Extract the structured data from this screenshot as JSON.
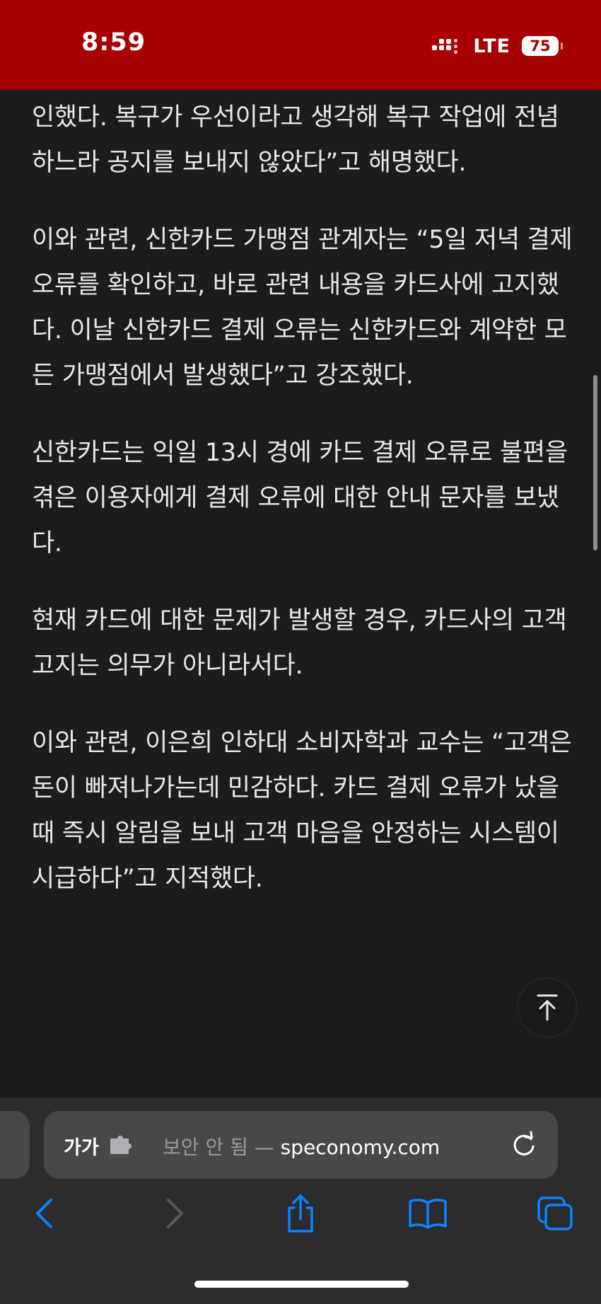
{
  "status_bar": {
    "time": "8:59",
    "network": "LTE",
    "battery_level": "75",
    "background_color": "#a80000"
  },
  "article": {
    "paragraphs": [
      "인했다. 복구가 우선이라고 생각해 복구 작업에 전념하느라 공지를 보내지 않았다”고 해명했다.",
      "이와 관련, 신한카드 가맹점 관계자는 “5일 저녁 결제 오류를 확인하고, 바로 관련 내용을 카드사에 고지했다. 이날 신한카드 결제 오류는 신한카드와 계약한 모든 가맹점에서 발생했다”고 강조했다.",
      "신한카드는 익일 13시 경에 카드 결제 오류로 불편을 겪은 이용자에게 결제 오류에 대한 안내 문자를 보냈다.",
      "현재 카드에 대한 문제가 발생할 경우, 카드사의 고객 고지는 의무가 아니라서다.",
      "이와 관련, 이은희 인하대 소비자학과 교수는 “고객은 돈이 빠져나가는데 민감하다. 카드 결제 오류가 났을 때 즉시 알림을 보내 고객 마음을 안정하는 시스템이 시급하다”고 지적했다."
    ]
  },
  "address_bar": {
    "reader_label": "가가",
    "security_prefix": "보안 안 됨 —",
    "domain": "speconomy.com"
  },
  "icons": {
    "scroll_top": "arrow-up-to-line-icon",
    "extension": "puzzle-icon",
    "reload": "reload-icon",
    "back": "chevron-left-icon",
    "forward": "chevron-right-icon",
    "share": "share-icon",
    "bookmarks": "book-icon",
    "tabs": "tabs-icon"
  },
  "colors": {
    "accent": "#0a84ff",
    "toolbar_bg": "#2c2c2e",
    "page_bg": "#1c1c1e"
  }
}
